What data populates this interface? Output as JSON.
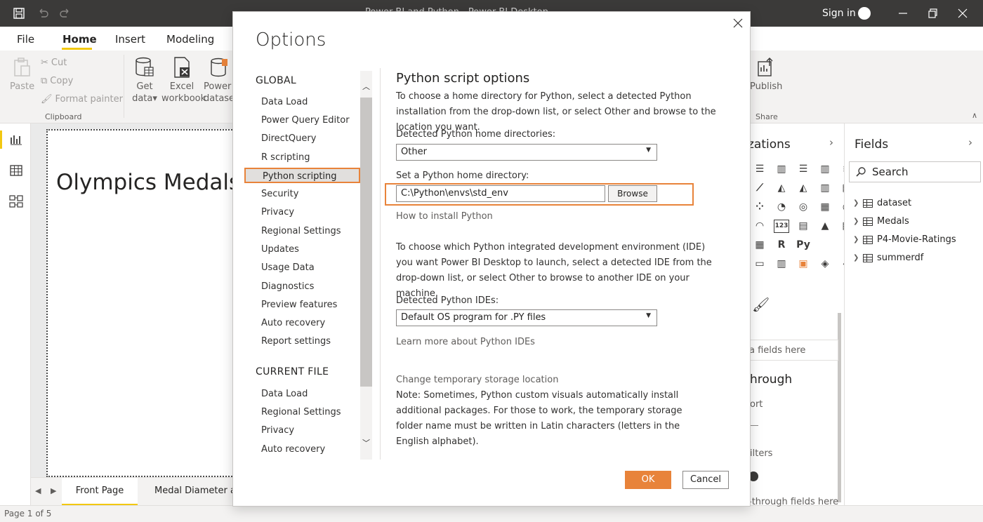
{
  "titlebar": {
    "title": "Power BI and Python - Power BI Desktop",
    "sign_in": "Sign in"
  },
  "menu": {
    "tabs": [
      "File",
      "Home",
      "Insert",
      "Modeling"
    ],
    "active": "Home"
  },
  "ribbon": {
    "clipboard": {
      "paste": "Paste",
      "cut": "Cut",
      "copy": "Copy",
      "format_painter": "Format painter",
      "group_label": "Clipboard"
    },
    "get_data": [
      "Get",
      "data"
    ],
    "excel": [
      "Excel",
      "workbook"
    ],
    "power": [
      "Power",
      "datase"
    ],
    "publish": "Publish",
    "share_group": "Share"
  },
  "report": {
    "title": "Olympics Medals",
    "page_tabs": [
      "Front Page",
      "Medal Diameter an"
    ],
    "status": "Page 1 of 5"
  },
  "viz_pane": {
    "title": "zations",
    "drag_fields": "a fields here",
    "drillthrough": "hrough",
    "report": "ort",
    "filters": "ilters",
    "drillthrough_fields": "-through fields here",
    "icons": [
      "stacked-bar-icon",
      "stacked-column-icon",
      "clustered-bar-icon",
      "clustered-column-icon",
      "100-bar-icon",
      "line-chart-icon",
      "area-chart-icon",
      "stacked-area-icon",
      "line-column-icon",
      "ribbon-chart-icon",
      "scatter-icon",
      "pie-chart-icon",
      "donut-chart-icon",
      "treemap-icon",
      "map-icon",
      "gauge-icon",
      "card-icon",
      "multirow-card-icon",
      "kpi-icon",
      "slicer-icon",
      "table-icon",
      "r-visual-icon",
      "python-visual-icon",
      "",
      "",
      "decomposition-icon",
      "smart-narrative-icon",
      "paginated-icon",
      "qa-icon",
      "more-visuals-icon"
    ],
    "r_label": "R",
    "py_label": "Py",
    "number_label": "123"
  },
  "fields_pane": {
    "title": "Fields",
    "search_placeholder": "Search",
    "tables": [
      "dataset",
      "Medals",
      "P4-Movie-Ratings",
      "summerdf"
    ]
  },
  "dialog": {
    "title": "Options",
    "nav": {
      "global_heading": "GLOBAL",
      "global_items": [
        "Data Load",
        "Power Query Editor",
        "DirectQuery",
        "R scripting",
        "Python scripting",
        "Security",
        "Privacy",
        "Regional Settings",
        "Updates",
        "Usage Data",
        "Diagnostics",
        "Preview features",
        "Auto recovery",
        "Report settings"
      ],
      "selected": "Python scripting",
      "current_heading": "CURRENT FILE",
      "current_items": [
        "Data Load",
        "Regional Settings",
        "Privacy",
        "Auto recovery"
      ]
    },
    "content": {
      "title": "Python script options",
      "intro": "To choose a home directory for Python, select a detected Python installation from the drop-down list, or select Other and browse to the location you want.",
      "detected_label": "Detected Python home directories:",
      "detected_value": "Other",
      "set_label": "Set a Python home directory:",
      "path_value": "C:\\Python\\envs\\std_env",
      "browse": "Browse",
      "how_to_link": "How to install Python",
      "ide_intro": "To choose which Python integrated development environment (IDE) you want Power BI Desktop to launch, select a detected IDE from the drop-down list, or select Other to browse to another IDE on your machine.",
      "ide_label": "Detected Python IDEs:",
      "ide_value": "Default OS program for .PY files",
      "ide_link": "Learn more about Python IDEs",
      "storage_link": "Change temporary storage location",
      "note": "Note: Sometimes, Python custom visuals automatically install additional packages. For those to work, the temporary storage folder name must be written in Latin characters (letters in the English alphabet)."
    },
    "buttons": {
      "ok": "OK",
      "cancel": "Cancel"
    }
  },
  "colors": {
    "accent": "#e8833a",
    "brand_yellow": "#f2c811",
    "titlebar": "#3b3a39"
  }
}
